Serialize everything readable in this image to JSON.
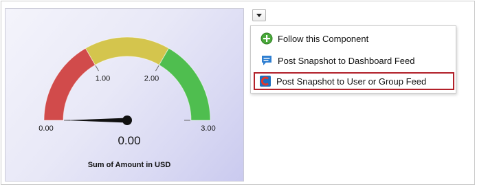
{
  "gauge": {
    "title": "Sum of Amount in USD",
    "value_display": "0.00",
    "tick_labels": [
      "0.00",
      "1.00",
      "2.00",
      "3.00"
    ],
    "ticks": [
      0,
      1,
      2,
      3
    ],
    "value": 0,
    "min": 0,
    "max": 3,
    "bands": [
      {
        "from": 0,
        "to": 1,
        "color": "#d14b4b"
      },
      {
        "from": 1,
        "to": 2,
        "color": "#d4c54d"
      },
      {
        "from": 2,
        "to": 3,
        "color": "#4fbe4f"
      }
    ]
  },
  "menu": {
    "toggle_icon": "chevron-down-icon",
    "items": [
      {
        "label": "Follow this Component",
        "icon": "plus-circle-icon",
        "icon_color": "#4aa93b"
      },
      {
        "label": "Post Snapshot to Dashboard Feed",
        "icon": "chat-bubble-icon",
        "icon_color": "#2f7fd1"
      },
      {
        "label": "Post Snapshot to User or Group Feed",
        "icon": "chatter-icon",
        "icon_color": "#e0362c"
      }
    ],
    "highlight_color": "#b22029"
  }
}
